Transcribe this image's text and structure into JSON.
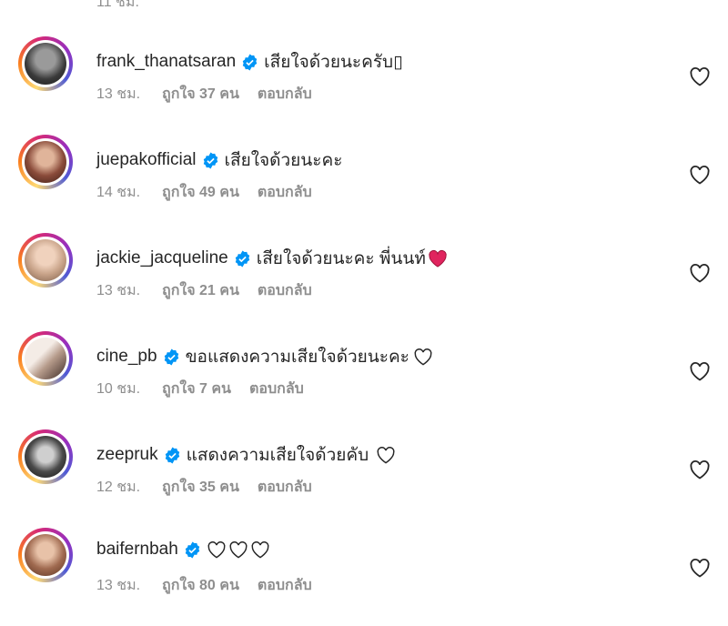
{
  "top_partial_text": "11 ชม.",
  "comments": [
    {
      "username": "frank_thanatsaran",
      "text": "เสียใจด้วยนะครับ▯",
      "time": "13 ชม.",
      "likes": "ถูกใจ 37 คน",
      "reply": "ตอบกลับ",
      "avatar_color": "#3a3a3a",
      "trailing": "none"
    },
    {
      "username": "juepakofficial",
      "text": "เสียใจด้วยนะคะ",
      "time": "14 ชม.",
      "likes": "ถูกใจ 49 คน",
      "reply": "ตอบกลับ",
      "avatar_color": "#8a4b3a",
      "trailing": "none"
    },
    {
      "username": "jackie_jacqueline",
      "text": "เสียใจด้วยนะคะ พี่นนท์",
      "time": "13 ชม.",
      "likes": "ถูกใจ 21 คน",
      "reply": "ตอบกลับ",
      "avatar_color": "#c9a48a",
      "trailing": "red-heart"
    },
    {
      "username": "cine_pb",
      "text": "ขอแสดงความเสียใจด้วยนะคะ",
      "time": "10 ชม.",
      "likes": "ถูกใจ 7 คน",
      "reply": "ตอบกลับ",
      "avatar_color": "#b59a8a",
      "trailing": "white-heart"
    },
    {
      "username": "zeepruk",
      "text": "แสดงความเสียใจด้วยคับ",
      "time": "12 ชม.",
      "likes": "ถูกใจ 35 คน",
      "reply": "ตอบกลับ",
      "avatar_color": "#4a4a4a",
      "trailing": "white-heart"
    },
    {
      "username": "baifernbah",
      "text": "",
      "time": "13 ชม.",
      "likes": "ถูกใจ 80 คน",
      "reply": "ตอบกลับ",
      "avatar_color": "#a06a50",
      "trailing": "three-white-hearts"
    }
  ],
  "colors": {
    "verified": "#0095f6",
    "muted": "#8e8e8e",
    "red_heart": "#e0245e"
  }
}
